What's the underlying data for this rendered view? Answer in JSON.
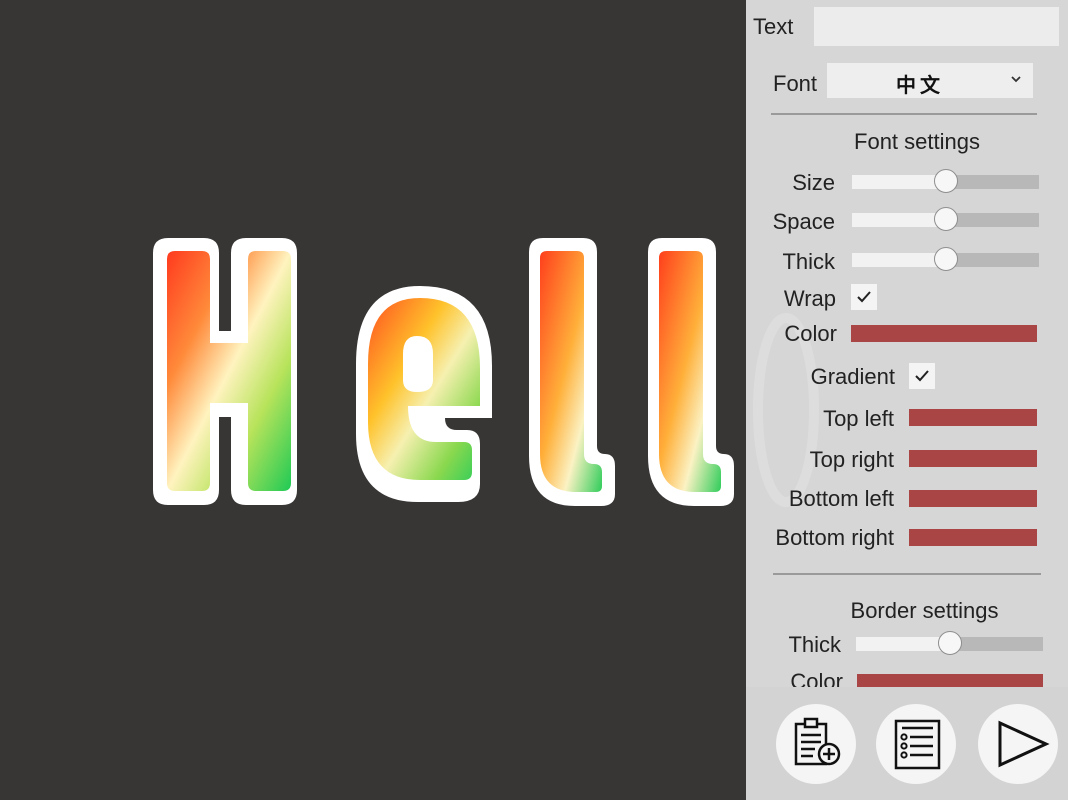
{
  "preview": {
    "text": "Hell",
    "ghost_text": "o",
    "fill_gradient": {
      "top_left": "#ff3a1e",
      "top_right": "#ffd02a",
      "middle": "#fff3bf",
      "bottom_left": "#e8f6d8",
      "bottom_right": "#1fca55"
    },
    "border_color": "#ffffff",
    "background": "#383635"
  },
  "panel": {
    "text_label": "Text",
    "text_value": "",
    "font_label": "Font",
    "font_value": "中文",
    "font_settings_title": "Font settings",
    "size_label": "Size",
    "size_value": 0.5,
    "space_label": "Space",
    "space_value": 0.5,
    "thick_label": "Thick",
    "thick_value": 0.5,
    "wrap_label": "Wrap",
    "wrap_checked": true,
    "color_label": "Color",
    "color_value": "#a94545",
    "gradient_label": "Gradient",
    "gradient_checked": true,
    "top_left_label": "Top left",
    "top_left_color": "#a94545",
    "top_right_label": "Top right",
    "top_right_color": "#a94545",
    "bottom_left_label": "Bottom left",
    "bottom_left_color": "#a94545",
    "bottom_right_label": "Bottom right",
    "bottom_right_color": "#a94545",
    "border_settings_title": "Border settings",
    "border_thick_label": "Thick",
    "border_thick_value": 0.5,
    "border_color_label": "Color",
    "border_color_value": "#a94545"
  },
  "toolbar": {
    "paste_add_icon": "clipboard-plus-icon",
    "list_icon": "checklist-icon",
    "play_icon": "play-icon"
  }
}
